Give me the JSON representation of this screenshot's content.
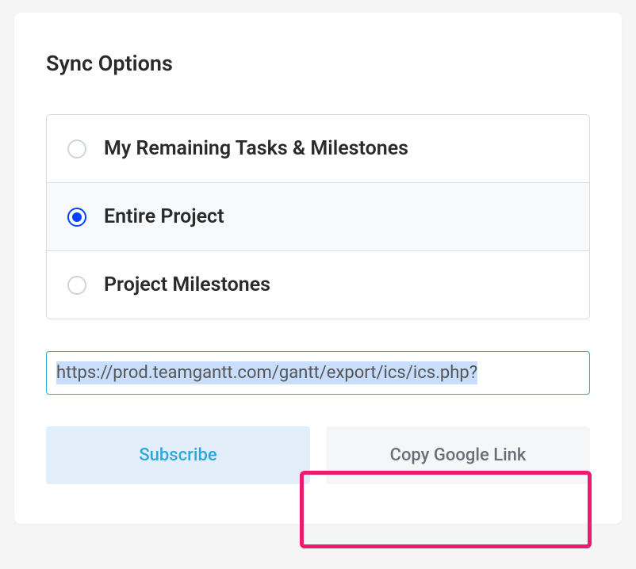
{
  "panel": {
    "title": "Sync Options"
  },
  "options": [
    {
      "label": "My Remaining Tasks & Milestones",
      "selected": false
    },
    {
      "label": "Entire Project",
      "selected": true
    },
    {
      "label": "Project Milestones",
      "selected": false
    }
  ],
  "url_field": {
    "value": "https://prod.teamgantt.com/gantt/export/ics/ics.php?"
  },
  "buttons": {
    "subscribe": "Subscribe",
    "copy_google": "Copy Google Link"
  }
}
